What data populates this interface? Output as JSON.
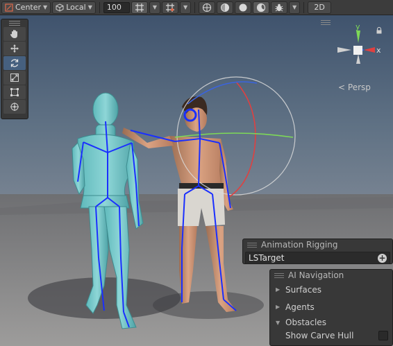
{
  "toolbar": {
    "pivot_label": "Center",
    "space_label": "Local",
    "snap_value": "100",
    "mode_2d": "2D"
  },
  "icons": {
    "pivot": "pivot-center-icon",
    "space": "local-cube-icon",
    "grid": "grid-snap-icon",
    "increment": "increment-snap-icon",
    "shading": "shading-icon",
    "effects": "effects-icon",
    "gizmos": "gizmo-bug-icon"
  },
  "tools": [
    "hand-tool",
    "move-tool",
    "rotate-tool",
    "scale-tool",
    "rect-tool",
    "transform-tool"
  ],
  "active_tool": "rotate-tool",
  "gizmo": {
    "y_label": "y",
    "x_label": "x",
    "projection_label": "Persp"
  },
  "overlays": {
    "animation_rigging": {
      "title": "Animation Rigging",
      "target_value": "LSTarget"
    },
    "ai_navigation": {
      "title": "AI Navigation",
      "sections": [
        {
          "label": "Surfaces",
          "expanded": false
        },
        {
          "label": "Agents",
          "expanded": false
        },
        {
          "label": "Obstacles",
          "expanded": true
        }
      ],
      "option_label": "Show Carve Hull"
    }
  },
  "colors": {
    "x_axis": "#e04040",
    "y_axis": "#7ed957",
    "z_axis": "#3a64e0",
    "bone": "#1a2fff",
    "active_tool": "#46607f"
  }
}
